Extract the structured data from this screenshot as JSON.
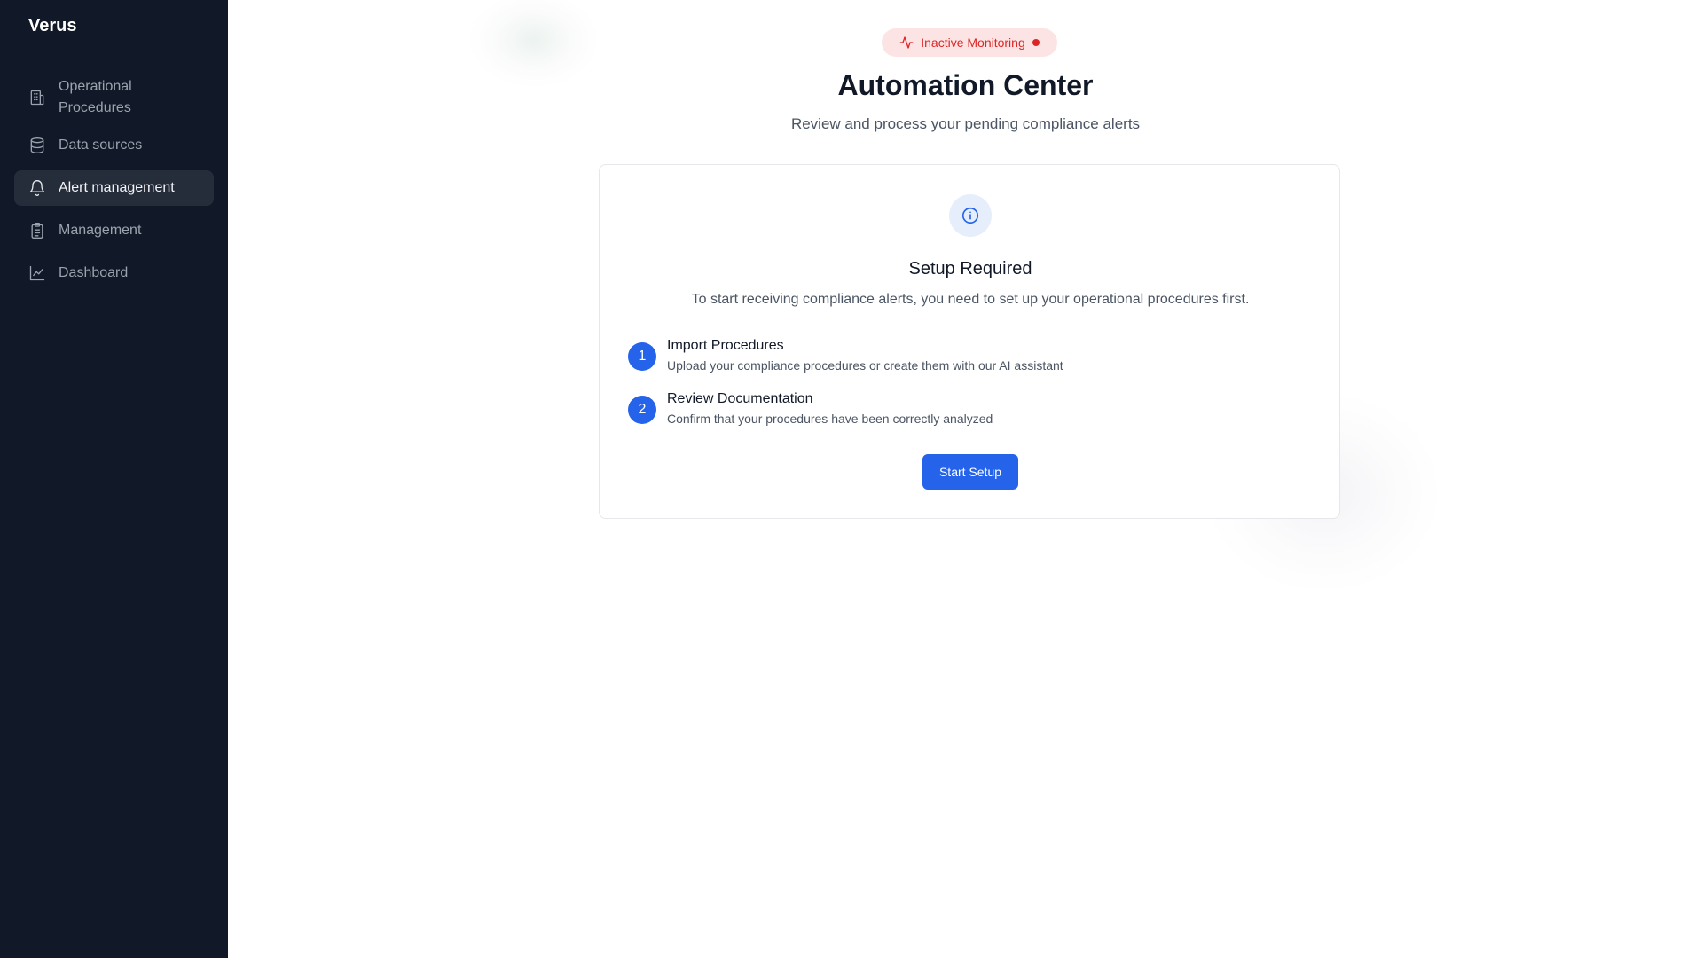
{
  "sidebar": {
    "brand": "Verus",
    "items": [
      {
        "label_line1": "Operational",
        "label_line2": "Procedures",
        "icon": "building-icon"
      },
      {
        "label": "Data sources",
        "icon": "database-icon"
      },
      {
        "label": "Alert management",
        "icon": "bell-icon",
        "active": true
      },
      {
        "label": "Management",
        "icon": "clipboard-icon"
      },
      {
        "label": "Dashboard",
        "icon": "line-chart-icon"
      }
    ]
  },
  "status_badge": {
    "label": "Inactive Monitoring",
    "icon": "activity-icon",
    "color": "#dc2626"
  },
  "header": {
    "title": "Automation Center",
    "subtitle": "Review and process your pending compliance alerts"
  },
  "setup_card": {
    "icon": "info-icon",
    "title": "Setup Required",
    "description": "To start receiving compliance alerts, you need to set up your operational procedures first.",
    "steps": [
      {
        "number": "1",
        "title": "Import Procedures",
        "description": "Upload your compliance procedures or create them with our AI assistant"
      },
      {
        "number": "2",
        "title": "Review Documentation",
        "description": "Confirm that your procedures have been correctly analyzed"
      }
    ],
    "button_label": "Start Setup"
  },
  "colors": {
    "sidebar_bg": "#111827",
    "accent": "#2563eb",
    "danger": "#dc2626"
  }
}
